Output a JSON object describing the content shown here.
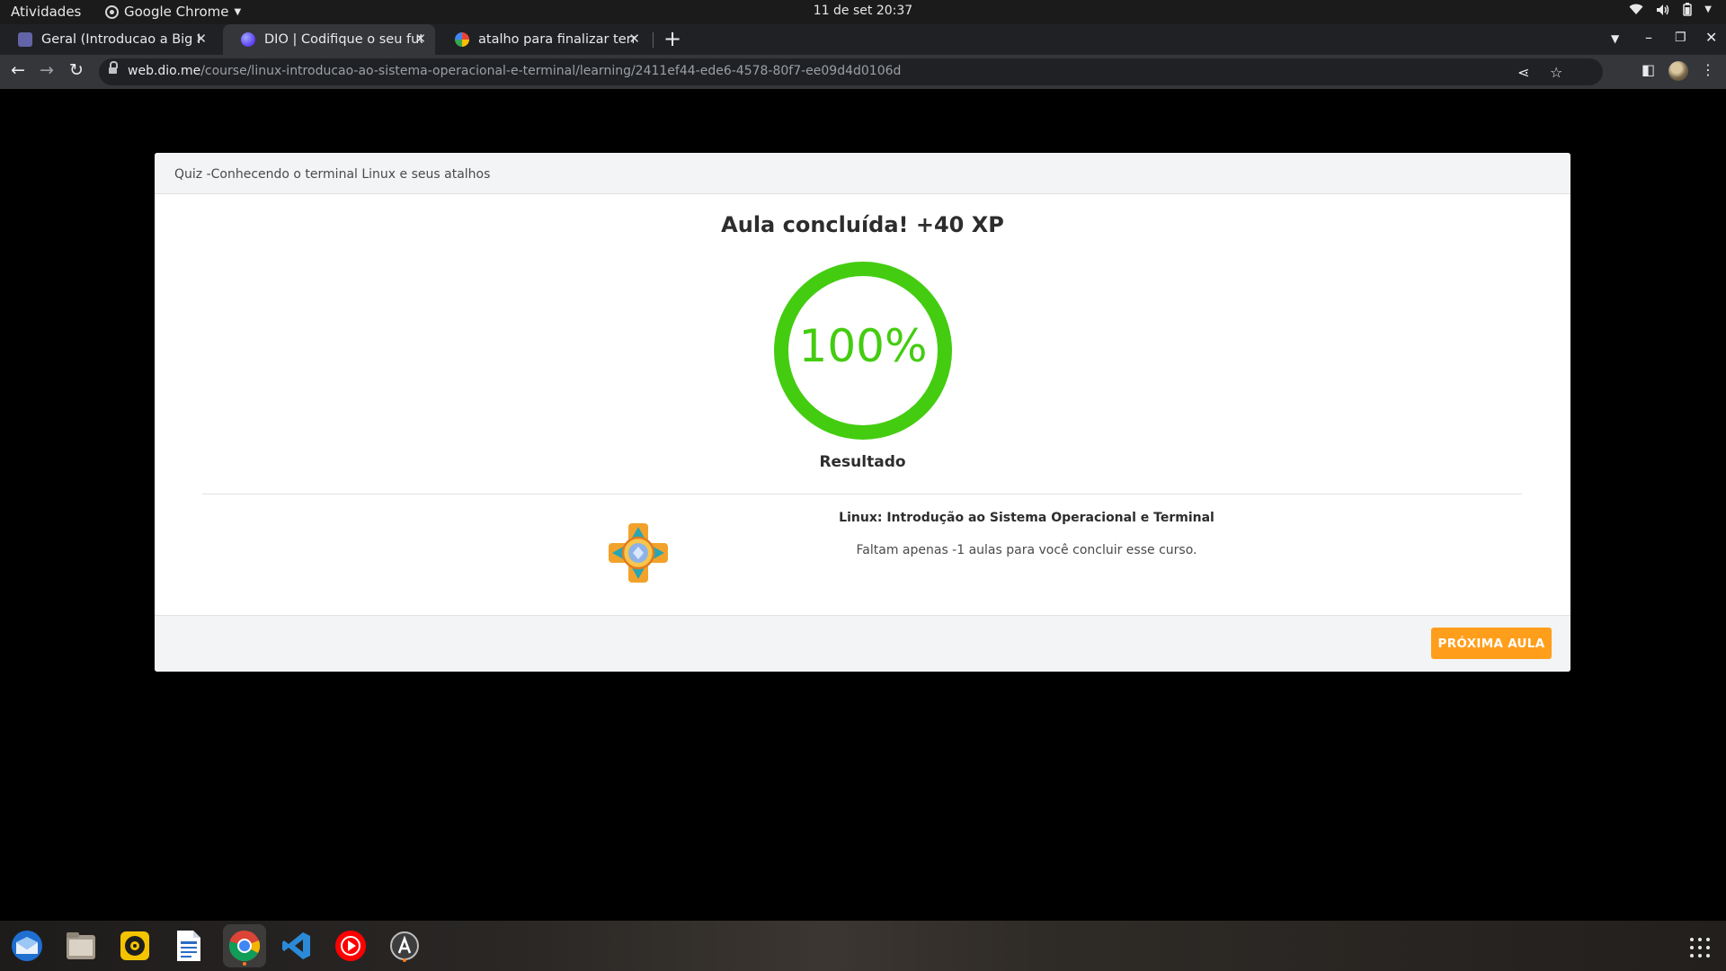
{
  "system_bar": {
    "activities": "Atividades",
    "app_name": "Google Chrome",
    "clock": "11 de set  20:37"
  },
  "tabs": [
    {
      "title": "Geral (Introducao a Big Data",
      "favicon_color": "#6264a7",
      "icon": "teams-icon"
    },
    {
      "title": "DIO | Codifique o seu futuro",
      "favicon_color": "#7c4dff",
      "icon": "dio-icon"
    },
    {
      "title": "atalho para finalizar terminal",
      "favicon_color": "#4285f4",
      "icon": "google-icon"
    }
  ],
  "address_bar": {
    "host": "web.dio.me",
    "path": "/course/linux-introducao-ao-sistema-operacional-e-terminal/learning/2411ef44-ede6-4578-80f7-ee09d4d0106d"
  },
  "quiz": {
    "header": "Quiz -Conhecendo o terminal Linux e seus atalhos",
    "title": "Aula concluída! +40 XP",
    "score_percent": 100,
    "score_label": "100%",
    "result_label": "Resultado",
    "course_name": "Linux: Introdução ao Sistema Operacional e Terminal",
    "remaining_message": "Faltam apenas -1 aulas para você concluir esse curso.",
    "next_button": "PRÓXIMA AULA"
  },
  "colors": {
    "progress_ring": "#44cc11",
    "next_button": "#ff9e1b"
  },
  "dock": [
    {
      "name": "thunderbird-icon"
    },
    {
      "name": "files-icon"
    },
    {
      "name": "rhythmbox-icon"
    },
    {
      "name": "writer-icon"
    },
    {
      "name": "chrome-icon",
      "active": true
    },
    {
      "name": "vscode-icon"
    },
    {
      "name": "youtube-music-icon"
    },
    {
      "name": "software-icon"
    }
  ]
}
